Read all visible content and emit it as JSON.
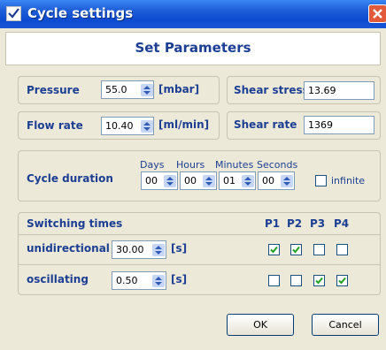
{
  "window": {
    "title": "Cycle settings"
  },
  "header": {
    "title": "Set Parameters"
  },
  "pressure": {
    "label": "Pressure",
    "value": "55.0",
    "unit": "[mbar]"
  },
  "flow_rate": {
    "label": "Flow rate",
    "value": "10.40",
    "unit": "[ml/min]"
  },
  "shear_stress": {
    "label": "Shear stress",
    "value": "13.69"
  },
  "shear_rate": {
    "label": "Shear rate",
    "value": "1369"
  },
  "cycle": {
    "label": "Cycle duration",
    "headers": {
      "days": "Days",
      "hours": "Hours",
      "minutes": "Minutes",
      "seconds": "Seconds"
    },
    "values": {
      "days": "00",
      "hours": "00",
      "minutes": "01",
      "seconds": "00"
    },
    "infinite_label": "infinite",
    "infinite_checked": false
  },
  "switching": {
    "title": "Switching times",
    "columns": [
      "P1",
      "P2",
      "P3",
      "P4"
    ],
    "unit": "[s]",
    "rows": [
      {
        "label": "unidirectional",
        "value": "30.00",
        "checks": [
          true,
          true,
          false,
          false
        ]
      },
      {
        "label": "oscillating",
        "value": "0.50",
        "checks": [
          false,
          false,
          true,
          true
        ]
      }
    ]
  },
  "buttons": {
    "ok": "OK",
    "cancel": "Cancel"
  }
}
